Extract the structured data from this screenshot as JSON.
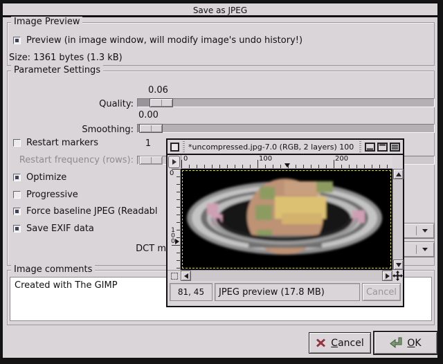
{
  "window": {
    "title": "Save as JPEG"
  },
  "image_preview": {
    "frame_label": "Image Preview",
    "preview_label": "Preview (in image window, will modify image's undo history!)",
    "size_text": "Size: 1361 bytes (1.3 kB)"
  },
  "parameter_settings": {
    "frame_label": "Parameter Settings",
    "quality": {
      "label": "Quality:",
      "value": "0.06"
    },
    "smoothing": {
      "label": "Smoothing:",
      "value": "0.00"
    },
    "restart_markers_label": "Restart markers",
    "restart_spinner_value": "1",
    "restart_frequency_label": "Restart frequency (rows):",
    "optimize_label": "Optimize",
    "progressive_label": "Progressive",
    "force_baseline_label": "Force baseline JPEG (Readabl",
    "save_exif_label": "Save EXIF data",
    "dct_method_label_visible": "DCT m"
  },
  "checks": {
    "preview": true,
    "restart_markers": false,
    "optimize": true,
    "progressive": false,
    "force_baseline": true,
    "save_exif": true
  },
  "image_comments": {
    "frame_label": "Image comments",
    "text": "Created with The GIMP"
  },
  "actions": {
    "cancel_key": "C",
    "cancel_rest": "ancel",
    "ok_key": "O",
    "ok_rest": "K"
  },
  "image_window": {
    "title": "*uncompressed.jpg-7.0 (RGB, 2 layers) 100",
    "h_ruler_ticks": [
      "0",
      "100",
      "200"
    ],
    "v_ruler_ticks": [
      "0",
      "100"
    ],
    "position_value": "81, 45",
    "status_text": "JPEG preview (17.8 MB)",
    "cancel_label": "Cancel"
  },
  "colors": {
    "dialog_bg": "#d9d5d9",
    "canvas_bg": "#000000",
    "layer_boundary_yellow": "#e8e600",
    "cancel_icon_red": "#a8343c",
    "ok_icon_green": "#6b8f63",
    "checkbox_checked": "#3e4254"
  }
}
